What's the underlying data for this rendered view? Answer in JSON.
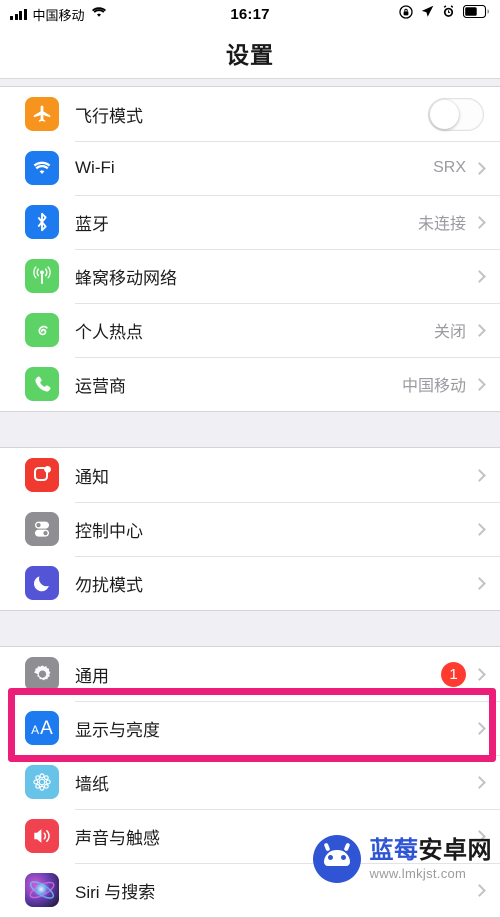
{
  "status_bar": {
    "carrier": "中国移动",
    "time": "16:17",
    "signal_bars": 4,
    "icons": [
      "signal-bars-icon",
      "wifi-icon",
      "rotation-lock-icon",
      "location-arrow-icon",
      "alarm-clock-icon",
      "battery-icon"
    ]
  },
  "nav": {
    "title": "设置"
  },
  "groups": [
    {
      "rows": [
        {
          "label": "飞行模式",
          "icon": "airplane-icon",
          "icon_color": "#F7941D",
          "control": "toggle",
          "toggle_on": false,
          "chevron": false,
          "detail": ""
        },
        {
          "label": "Wi-Fi",
          "icon": "wifi-icon",
          "icon_color": "#1E7BEF",
          "control": "detail",
          "detail": "SRX",
          "chevron": true
        },
        {
          "label": "蓝牙",
          "icon": "bluetooth-icon",
          "icon_color": "#1E7BEF",
          "control": "detail",
          "detail": "未连接",
          "chevron": true
        },
        {
          "label": "蜂窝移动网络",
          "icon": "cellular-icon",
          "icon_color": "#5CD364",
          "control": "detail",
          "detail": "",
          "chevron": true
        },
        {
          "label": "个人热点",
          "icon": "hotspot-icon",
          "icon_color": "#5CD364",
          "control": "detail",
          "detail": "关闭",
          "chevron": true
        },
        {
          "label": "运营商",
          "icon": "phone-icon",
          "icon_color": "#5CD364",
          "control": "detail",
          "detail": "中国移动",
          "chevron": true
        }
      ]
    },
    {
      "rows": [
        {
          "label": "通知",
          "icon": "notifications-icon",
          "icon_color": "#F03A2F",
          "control": "detail",
          "detail": "",
          "chevron": true
        },
        {
          "label": "控制中心",
          "icon": "control-center-icon",
          "icon_color": "#8E8E93",
          "control": "detail",
          "detail": "",
          "chevron": true
        },
        {
          "label": "勿扰模式",
          "icon": "moon-icon",
          "icon_color": "#5455D6",
          "control": "detail",
          "detail": "",
          "chevron": true
        }
      ]
    },
    {
      "rows": [
        {
          "label": "通用",
          "icon": "gear-icon",
          "icon_color": "#8E8E93",
          "control": "badge",
          "badge": "1",
          "detail": "",
          "chevron": true
        },
        {
          "label": "显示与亮度",
          "icon": "display-brightness-icon",
          "icon_color": "#1E7BEF",
          "control": "detail",
          "detail": "",
          "chevron": true,
          "highlighted": true
        },
        {
          "label": "墙纸",
          "icon": "wallpaper-icon",
          "icon_color": "#67C3E8",
          "control": "detail",
          "detail": "",
          "chevron": true
        },
        {
          "label": "声音与触感",
          "icon": "sound-haptics-icon",
          "icon_color": "#F0434F",
          "control": "detail",
          "detail": "",
          "chevron": true
        },
        {
          "label": "Siri 与搜索",
          "icon": "siri-icon",
          "icon_color": "#6A3FB5",
          "control": "detail",
          "detail": "",
          "chevron": true
        }
      ]
    }
  ],
  "highlight": {
    "color": "#ED1E79"
  },
  "watermark": {
    "brand_blue": "蓝莓",
    "brand_black": "安卓网",
    "url": "www.lmkjst.com",
    "logo_color": "#2F55D4"
  }
}
